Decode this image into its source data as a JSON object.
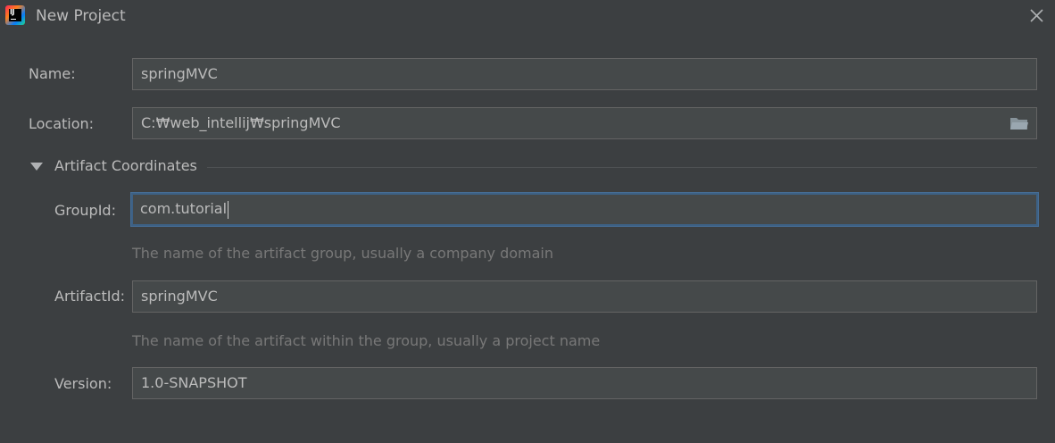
{
  "window": {
    "title": "New Project",
    "app_icon_text": "IJ",
    "icon": "intellij-idea-icon"
  },
  "form": {
    "name": {
      "label": "Name:",
      "value": "springMVC"
    },
    "location": {
      "label": "Location:",
      "value": "C:₩web_intellij₩springMVC",
      "browse_icon": "folder-icon"
    },
    "artifact_section": {
      "label": "Artifact Coordinates",
      "expanded": true
    },
    "group_id": {
      "label": "GroupId:",
      "value": "com.tutorial",
      "hint": "The name of the artifact group, usually a company domain"
    },
    "artifact_id": {
      "label": "ArtifactId:",
      "value": "springMVC",
      "hint": "The name of the artifact within the group, usually a project name"
    },
    "version": {
      "label": "Version:",
      "value": "1.0-SNAPSHOT"
    }
  },
  "colors": {
    "background": "#3c3f41",
    "field_background": "#45494a",
    "focus_border": "#3d6185",
    "hint_text": "#787878"
  }
}
